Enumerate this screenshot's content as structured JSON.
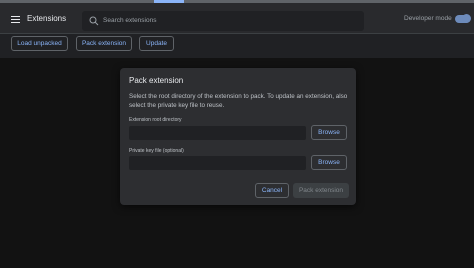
{
  "header": {
    "title": "Extensions",
    "search_placeholder": "Search extensions",
    "developer_mode_label": "Developer mode",
    "developer_mode_on": true
  },
  "toolbar": {
    "load_unpacked": "Load unpacked",
    "pack_extension": "Pack extension",
    "update": "Update"
  },
  "dialog": {
    "title": "Pack extension",
    "description": "Select the root directory of the extension to pack. To update an extension, also select the private key file to reuse.",
    "root_dir_label": "Extension root directory",
    "root_dir_value": "",
    "private_key_label": "Private key file (optional)",
    "private_key_value": "",
    "browse_label": "Browse",
    "cancel_label": "Cancel",
    "pack_label": "Pack extension"
  },
  "colors": {
    "accent": "#8ab4f8",
    "background": "#202124",
    "dialog_bg": "#2d2e31"
  },
  "icons": [
    "menu-icon",
    "search-icon"
  ]
}
